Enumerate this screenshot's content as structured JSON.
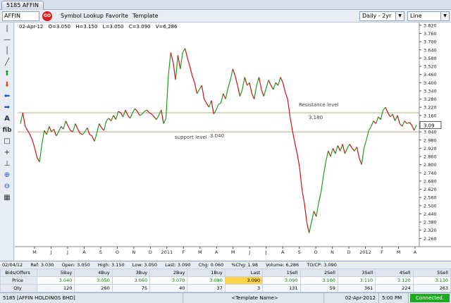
{
  "window": {
    "tab_title": "5185  AFFIN"
  },
  "toolbar": {
    "symbol_value": "AFFIN",
    "go_label": "GO",
    "menu": [
      "Symbol Lookup",
      "Favorite",
      "Template"
    ],
    "period_value": "Daily - 2yr",
    "chart_type_value": "Line"
  },
  "left_tools": [
    "cursor-tool",
    "horizontal-line-tool",
    "vertical-line-tool",
    "trend-line-tool",
    "up-arrow-tool",
    "down-arrow-tool",
    "left-arrow-tool",
    "right-arrow-tool",
    "text-tool",
    "fibonacci-tool",
    "select-box-tool",
    "crosshair-tool",
    "vertical-crosshair-tool",
    "zoom-in-tool",
    "zoom-out-tool",
    "zoom-fit-tool"
  ],
  "ohlc": {
    "date": "02-Apr-12",
    "open": "O=3.050",
    "high": "H=3.150",
    "low": "L=3.050",
    "close": "C=3.090",
    "volume": "V=6,286"
  },
  "chart_data": {
    "type": "line",
    "title": "",
    "xlabel": "",
    "ylabel": "",
    "ylim": [
      2.2,
      3.84
    ],
    "y_ticks": [
      "3.820",
      "3.760",
      "3.700",
      "3.640",
      "3.580",
      "3.520",
      "3.460",
      "3.400",
      "3.340",
      "3.280",
      "3.220",
      "3.160",
      "3.100",
      "3.040",
      "2.980",
      "2.920",
      "2.860",
      "2.800",
      "2.740",
      "2.680",
      "2.620",
      "2.560",
      "2.500",
      "2.440",
      "2.380",
      "2.320",
      "2.260"
    ],
    "x_ticks": [
      "M",
      "J",
      "J",
      "A",
      "S",
      "O",
      "N",
      "D",
      "2011",
      "F",
      "M",
      "A",
      "M",
      "J",
      "J",
      "A",
      "S",
      "O",
      "N",
      "D",
      "2012",
      "F",
      "M",
      "A"
    ],
    "current_price_label": "3.09",
    "series": [
      {
        "values": [
          3.1,
          3.18,
          3.08,
          3.05,
          3.02,
          2.98,
          2.92,
          2.85,
          2.82,
          2.95,
          3.05,
          3.02,
          3.08,
          3.04,
          3.06,
          3.01,
          3.04,
          3.08,
          3.06,
          3.12,
          3.08,
          3.05,
          3.04,
          3.1,
          3.06,
          3.03,
          3.02,
          3.04,
          3.07,
          3.02,
          3.01,
          2.97,
          3.03,
          3.1,
          3.07,
          3.05,
          3.12,
          3.14,
          3.12,
          3.16,
          3.13,
          3.19,
          3.18,
          3.15,
          3.2,
          3.16,
          3.14,
          3.18,
          3.21,
          3.19,
          3.16,
          3.17,
          3.19,
          3.2,
          3.18,
          3.17,
          3.15,
          3.13,
          3.16,
          3.2,
          3.1,
          3.14,
          3.45,
          3.62,
          3.55,
          3.42,
          3.6,
          3.5,
          3.62,
          3.65,
          3.58,
          3.52,
          3.45,
          3.4,
          3.32,
          3.35,
          3.38,
          3.28,
          3.25,
          3.22,
          3.27,
          3.17,
          3.2,
          3.24,
          3.25,
          3.32,
          3.28,
          3.36,
          3.42,
          3.5,
          3.45,
          3.38,
          3.3,
          3.35,
          3.44,
          3.38,
          3.4,
          3.32,
          3.28,
          3.38,
          3.44,
          3.35,
          3.3,
          3.36,
          3.42,
          3.38,
          3.35,
          3.4,
          3.38,
          3.44,
          3.4,
          3.33,
          3.28,
          3.15,
          3.05,
          2.96,
          2.88,
          2.78,
          2.62,
          2.52,
          2.38,
          2.3,
          2.38,
          2.46,
          2.42,
          2.52,
          2.6,
          2.72,
          2.82,
          2.9,
          2.86,
          2.92,
          2.88,
          2.94,
          2.9,
          2.95,
          2.88,
          2.92,
          2.95,
          2.92,
          2.9,
          2.93,
          2.85,
          2.8,
          2.92,
          2.98,
          3.05,
          3.08,
          3.12,
          3.1,
          3.15,
          3.13,
          3.2,
          3.22,
          3.18,
          3.15,
          3.17,
          3.12,
          3.16,
          3.1,
          3.08,
          3.12,
          3.1,
          3.11,
          3.09,
          3.05,
          3.09
        ]
      }
    ],
    "annotations": [
      {
        "text": "Resistance level",
        "value": 3.18
      },
      {
        "text": "3.180",
        "value": 3.18
      },
      {
        "text": "support level",
        "value": 3.04
      },
      {
        "text": "3.040",
        "value": 3.04
      }
    ],
    "colors": {
      "up": "#1aa01a",
      "down": "#d01010",
      "level_line": "#b8a888"
    },
    "grid": false,
    "legend": "none"
  },
  "quote_summary": {
    "date": "02/04/12",
    "ref": "Ref: 3.030",
    "open": "Open: 3.050",
    "high": "High: 3.150",
    "low": "Low: 3.050",
    "last": "Last: 3.090",
    "chg": "Chg: 0.060",
    "pchg": "%Chg: 1.98",
    "volume": "Volume: 6,286",
    "to_cp": "TO/CP: 3.090"
  },
  "depth": {
    "header": [
      "Bids/Offers",
      "5Buy",
      "4Buy",
      "3Buy",
      "2Buy",
      "1Buy",
      "Last",
      "1Sell",
      "2Sell",
      "3Sell",
      "4Sell",
      "5Sell"
    ],
    "price": [
      "Price",
      "3.040",
      "3.050",
      "3.060",
      "3.070",
      "3.080",
      "3.090",
      "3.090",
      "3.100",
      "3.110",
      "3.120",
      "3.130"
    ],
    "qty": [
      "Qty",
      "120",
      "260",
      "75",
      "40",
      "37",
      "3",
      "131",
      "59",
      "361",
      "224",
      "263"
    ]
  },
  "status": {
    "symbol": "5185 [AFFIN HOLDINGS BHD]",
    "template": "<Template Name>",
    "date": "02-Apr-2012",
    "time": "5:00 PM",
    "connection": "Connected."
  }
}
